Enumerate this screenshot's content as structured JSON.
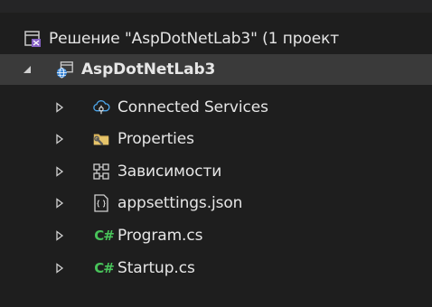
{
  "solution": {
    "label": "Решение \"AspDotNetLab3\" (1 проект",
    "icon": "solution-icon"
  },
  "project": {
    "label": "AspDotNetLab3",
    "icon": "web-project-icon",
    "expanded": true
  },
  "items": [
    {
      "label": "Connected Services",
      "icon": "connected-services-icon"
    },
    {
      "label": "Properties",
      "icon": "properties-folder-icon"
    },
    {
      "label": "Зависимости",
      "icon": "dependencies-icon"
    },
    {
      "label": "appsettings.json",
      "icon": "json-file-icon"
    },
    {
      "label": "Program.cs",
      "icon": "csharp-file-icon",
      "glyph": "C#"
    },
    {
      "label": "Startup.cs",
      "icon": "csharp-file-icon",
      "glyph": "C#"
    }
  ],
  "colors": {
    "background": "#1e1e1e",
    "selected_row": "#3a3a3a",
    "text": "#e6e6e6",
    "csharp_green": "#48c35a",
    "accent_blue": "#4ea6ea",
    "vs_purple": "#8661c5"
  }
}
